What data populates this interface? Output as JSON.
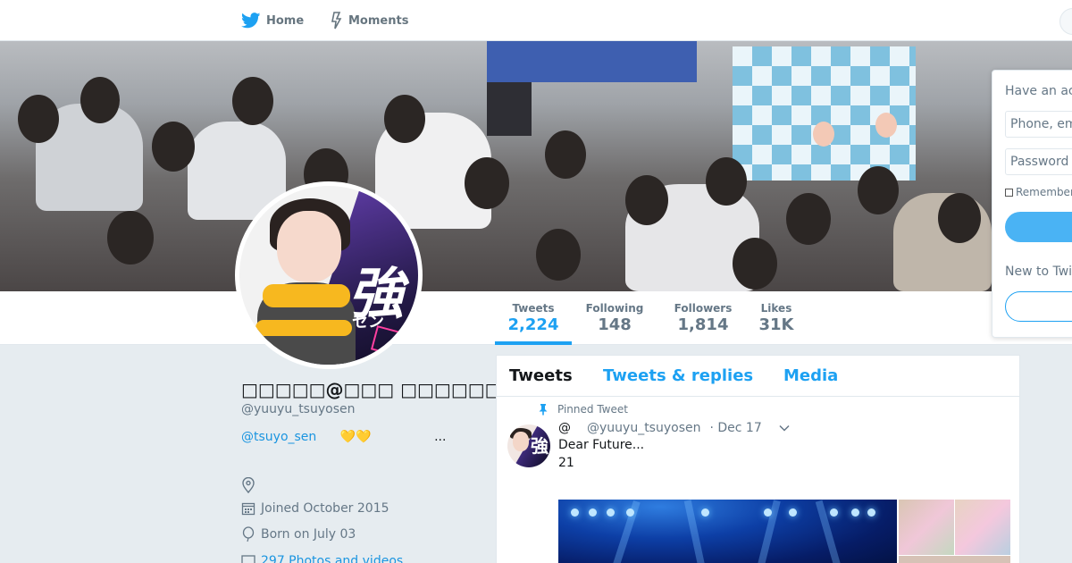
{
  "nav": {
    "home_label": "Home",
    "moments_label": "Moments"
  },
  "profile": {
    "name": "□□□□□@□□□ □□□□□□□□□□",
    "handle": "@yuuyu_tsuyosen",
    "bio_link": "@tsuyo_sen",
    "bio_hearts": "💛💛",
    "bio_more": "...",
    "location": "",
    "joined": "Joined October 2015",
    "born": "Born on July 03",
    "url": "297 Photos and videos"
  },
  "stats": [
    {
      "label": "Tweets",
      "value": "2,224"
    },
    {
      "label": "Following",
      "value": "148"
    },
    {
      "label": "Followers",
      "value": "1,814"
    },
    {
      "label": "Likes",
      "value": "31K"
    }
  ],
  "timeline": {
    "tabs": [
      "Tweets",
      "Tweets & replies",
      "Media"
    ],
    "pinned_label": "Pinned Tweet",
    "tweet": {
      "name": "@",
      "handle": "@yuuyu_tsuyosen",
      "date": "· Dec 17",
      "line1": "Dear Future...",
      "line2": "21"
    }
  },
  "avatar": {
    "kanji": "強",
    "kana": "セン"
  },
  "login": {
    "title": "Have an account?",
    "phone_placeholder": "Phone, email or username",
    "password_placeholder": "Password",
    "remember": "Remember me",
    "new_label": "New to Twitter?"
  },
  "colors": {
    "accent": "#1da1f2",
    "link": "#1b95e0",
    "page_bg": "#e6ecf0"
  }
}
